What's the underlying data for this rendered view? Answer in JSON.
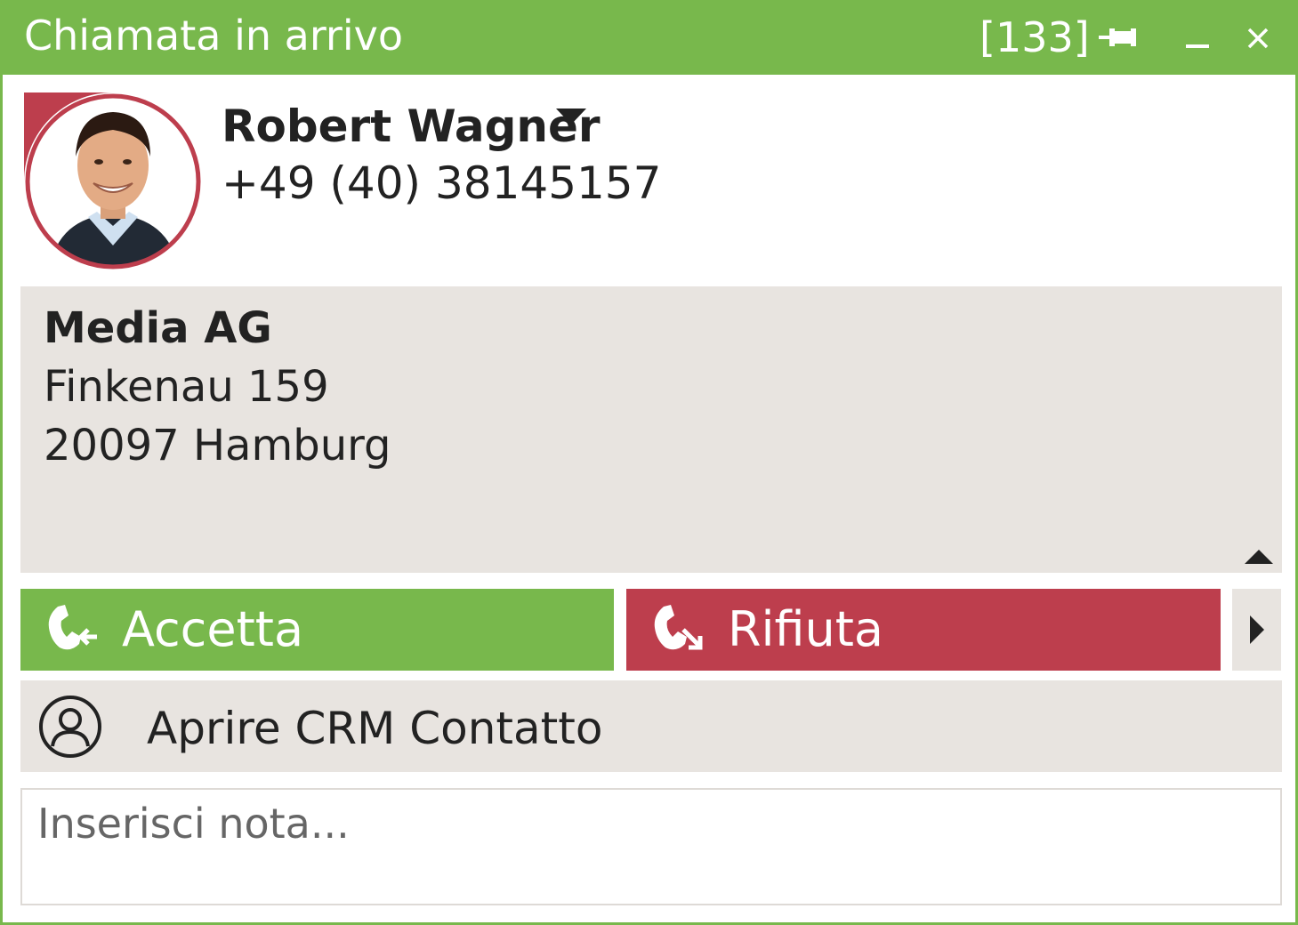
{
  "window": {
    "title": "Chiamata in arrivo",
    "count_badge": "[133]",
    "colors": {
      "accent": "#78b84c",
      "reject": "#bd3e4d",
      "panel": "#e8e4e0"
    },
    "controls": [
      "pin-icon",
      "minimize-icon",
      "close-icon"
    ]
  },
  "contact": {
    "name": "Robert Wagner",
    "phone": "+49 (40) 38145157",
    "company": "Media AG",
    "street": "Finkenau 159",
    "city": "20097 Hamburg"
  },
  "actions": {
    "accept_label": "Accetta",
    "reject_label": "Rifiuta",
    "crm_label": "Aprire CRM Contatto"
  },
  "note": {
    "placeholder": "Inserisci nota...",
    "value": ""
  }
}
